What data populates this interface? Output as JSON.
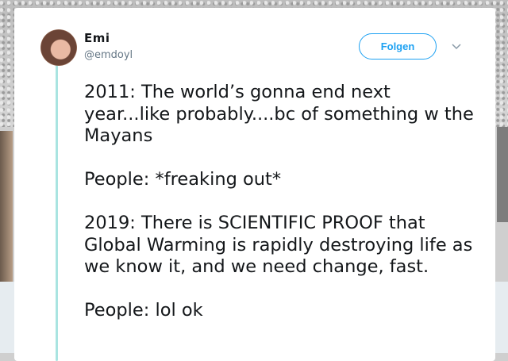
{
  "tweet": {
    "author_name": "Emi",
    "author_handle": "@emdoyl",
    "follow_label": "Folgen",
    "text": "2011: The world’s gonna end next year...like probably....bc of something w the Mayans\n\nPeople: *freaking out*\n\n2019: There is SCIENTIFIC PROOF that Global Warming is rapidly destroying life as we know it, and we need change, fast.\n\nPeople: lol ok"
  },
  "icons": {
    "avatar": "avatar",
    "more_menu": "chevron-down-icon"
  },
  "colors": {
    "accent": "#1da1f2",
    "thread_line": "#a9e4e1",
    "text": "#14171a",
    "secondary_text": "#657786"
  }
}
